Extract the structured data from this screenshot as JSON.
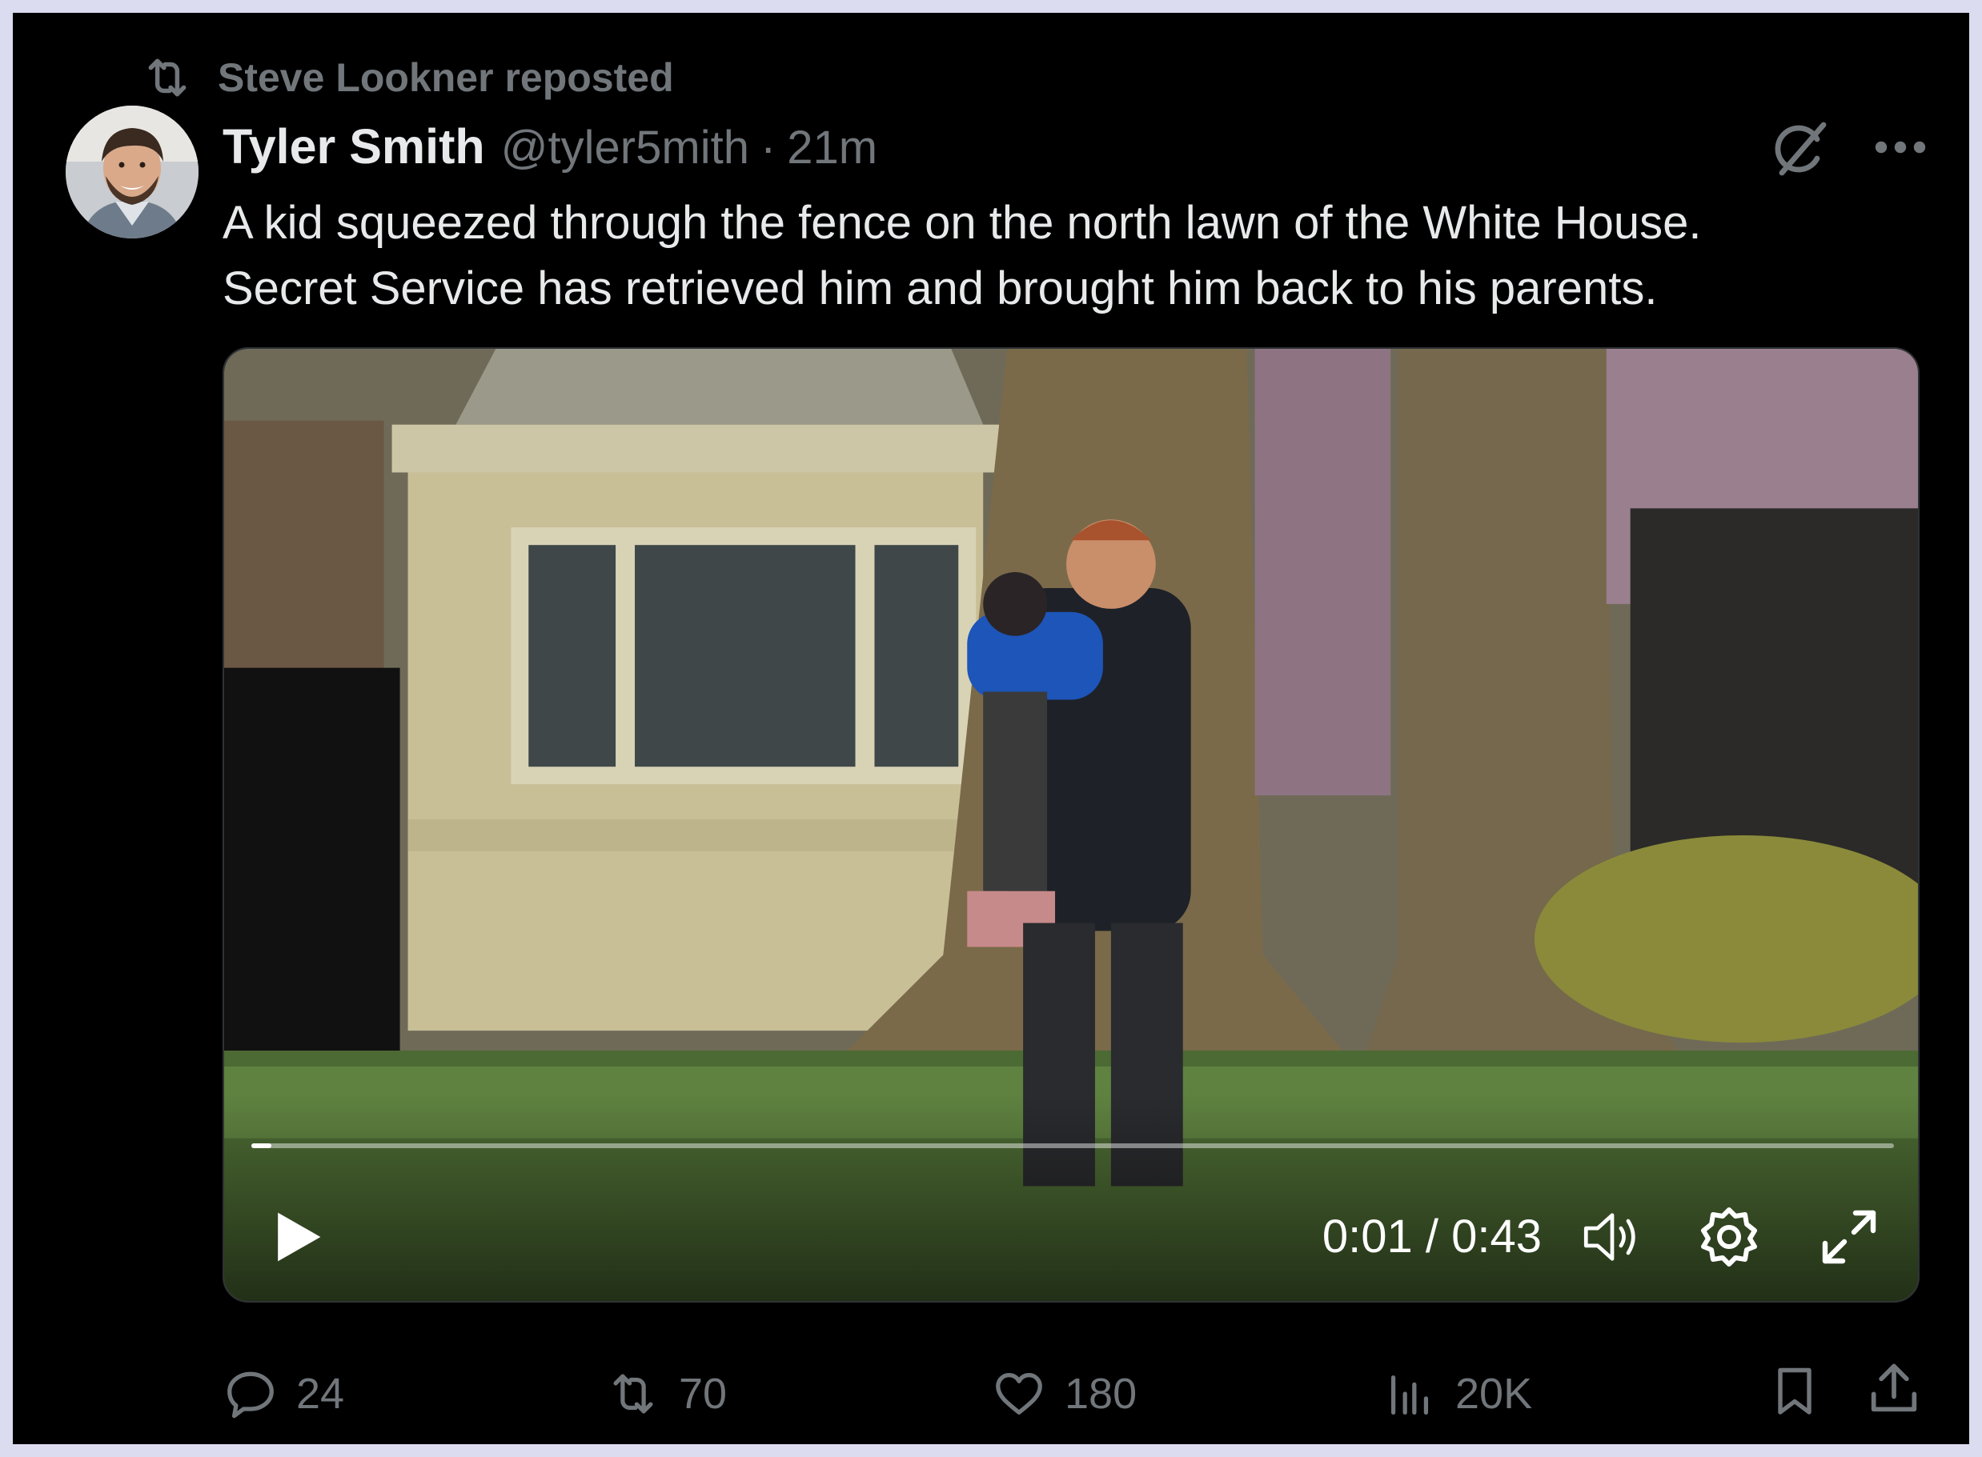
{
  "repost_banner": {
    "text": "Steve Lookner reposted",
    "icon": "repost-icon"
  },
  "author": {
    "name": "Tyler Smith",
    "handle": "@tyler5mith",
    "separator": "·",
    "time": "21m",
    "avatar": "avatar-photo"
  },
  "header_icons": [
    "grok-icon",
    "more-icon"
  ],
  "post": {
    "text_line1": "A kid squeezed through the fence on the north lawn of the White House.",
    "text_line2": "Secret Service has retrieved him and brought him back to his parents."
  },
  "video": {
    "time_readout": "0:01 / 0:43",
    "progress_fraction": 0.012,
    "controls": [
      "play-icon",
      "volume-icon",
      "settings-icon",
      "fullscreen-icon"
    ]
  },
  "actions": {
    "replies": "24",
    "reposts": "70",
    "likes": "180",
    "views": "20K",
    "extra": [
      "bookmark-icon",
      "share-icon"
    ]
  },
  "colors": {
    "background": "#000000",
    "text": "#e7e9ea",
    "muted": "#71767b",
    "frame": "#dcdcf0"
  }
}
